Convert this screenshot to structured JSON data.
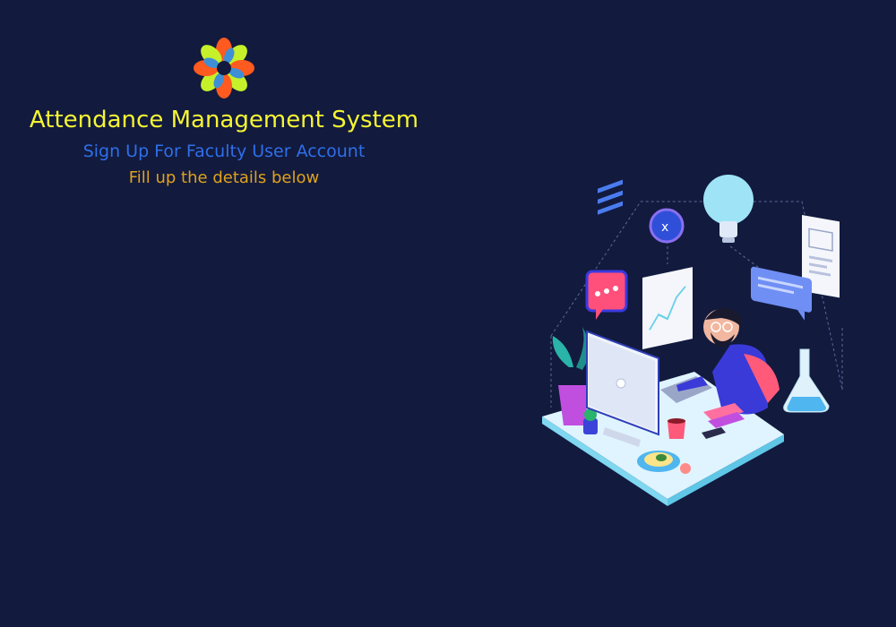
{
  "header": {
    "app_title": "Attendance Management System",
    "subtitle": "Sign Up For Faculty User Account",
    "instruction": "Fill up the details below"
  },
  "colors": {
    "background": "#121a3e",
    "title": "#f5f534",
    "subtitle": "#2f6fe8",
    "instruction": "#e0a21c"
  },
  "icons": {
    "logo": "flower-logo-icon",
    "illustration": "person-working-at-computer-illustration"
  }
}
